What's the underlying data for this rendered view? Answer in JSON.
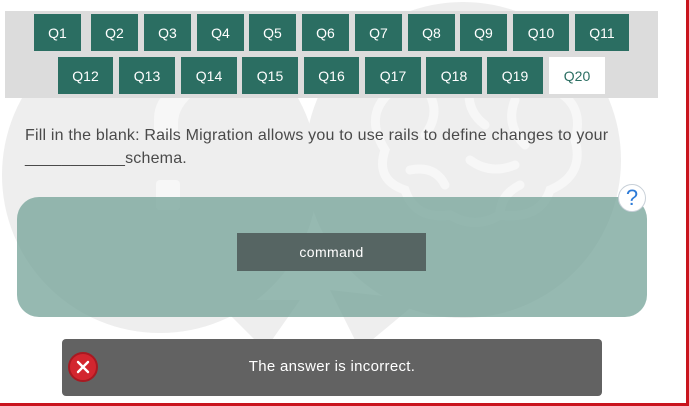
{
  "questions": [
    {
      "label": "Q1"
    },
    {
      "label": "Q2"
    },
    {
      "label": "Q3"
    },
    {
      "label": "Q4"
    },
    {
      "label": "Q5"
    },
    {
      "label": "Q6"
    },
    {
      "label": "Q7"
    },
    {
      "label": "Q8"
    },
    {
      "label": "Q9"
    },
    {
      "label": "Q10"
    },
    {
      "label": "Q11"
    },
    {
      "label": "Q12"
    },
    {
      "label": "Q13"
    },
    {
      "label": "Q14"
    },
    {
      "label": "Q15"
    },
    {
      "label": "Q16"
    },
    {
      "label": "Q17"
    },
    {
      "label": "Q18"
    },
    {
      "label": "Q19"
    },
    {
      "label": "Q20"
    }
  ],
  "active_question": "Q20",
  "question_text": "Fill in the blank: Rails Migration allows you to use rails to define changes to your ___________schema.",
  "help_icon": "question-mark-icon",
  "answer_option": "command",
  "feedback": {
    "icon": "error-x-icon",
    "text": "The answer is incorrect."
  },
  "colors": {
    "accent": "#2b6e62",
    "error": "#d3262f",
    "border": "#c9141d"
  }
}
